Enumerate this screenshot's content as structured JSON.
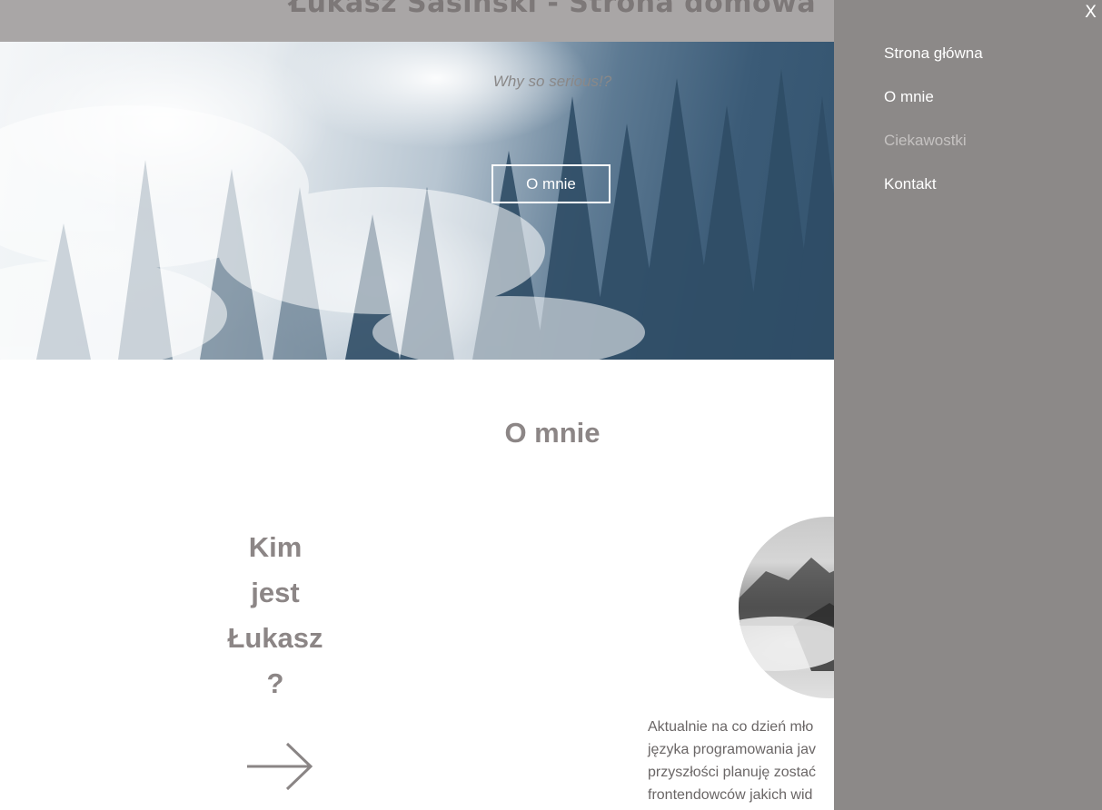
{
  "header": {
    "site_title": "Łukasz Sasiński - Strona domowa"
  },
  "hero": {
    "tagline": "Why so serious!?",
    "button_label": "O mnie",
    "image_icon": "forest-fog-image"
  },
  "about": {
    "section_title": "O mnie",
    "who_heading_lines": [
      "Kim",
      "jest",
      "Łukasz",
      "?"
    ],
    "arrow_icon": "arrow-right-icon",
    "avatar_icon": "mountain-avatar-image",
    "text_lines": [
      "Aktualnie na co dzień mło",
      "języka programowania jav",
      "przyszłości planuję zostać",
      "frontendowców jakich wid"
    ]
  },
  "menu": {
    "close_label": "X",
    "items": [
      {
        "label": "Strona główna",
        "active": false
      },
      {
        "label": "O mnie",
        "active": false
      },
      {
        "label": "Ciekawostki",
        "active": true
      },
      {
        "label": "Kontakt",
        "active": false
      }
    ]
  },
  "colors": {
    "menu_bg": "#8c8988",
    "accent_text": "#8c8686",
    "header_bg": "#a9a6a6"
  }
}
